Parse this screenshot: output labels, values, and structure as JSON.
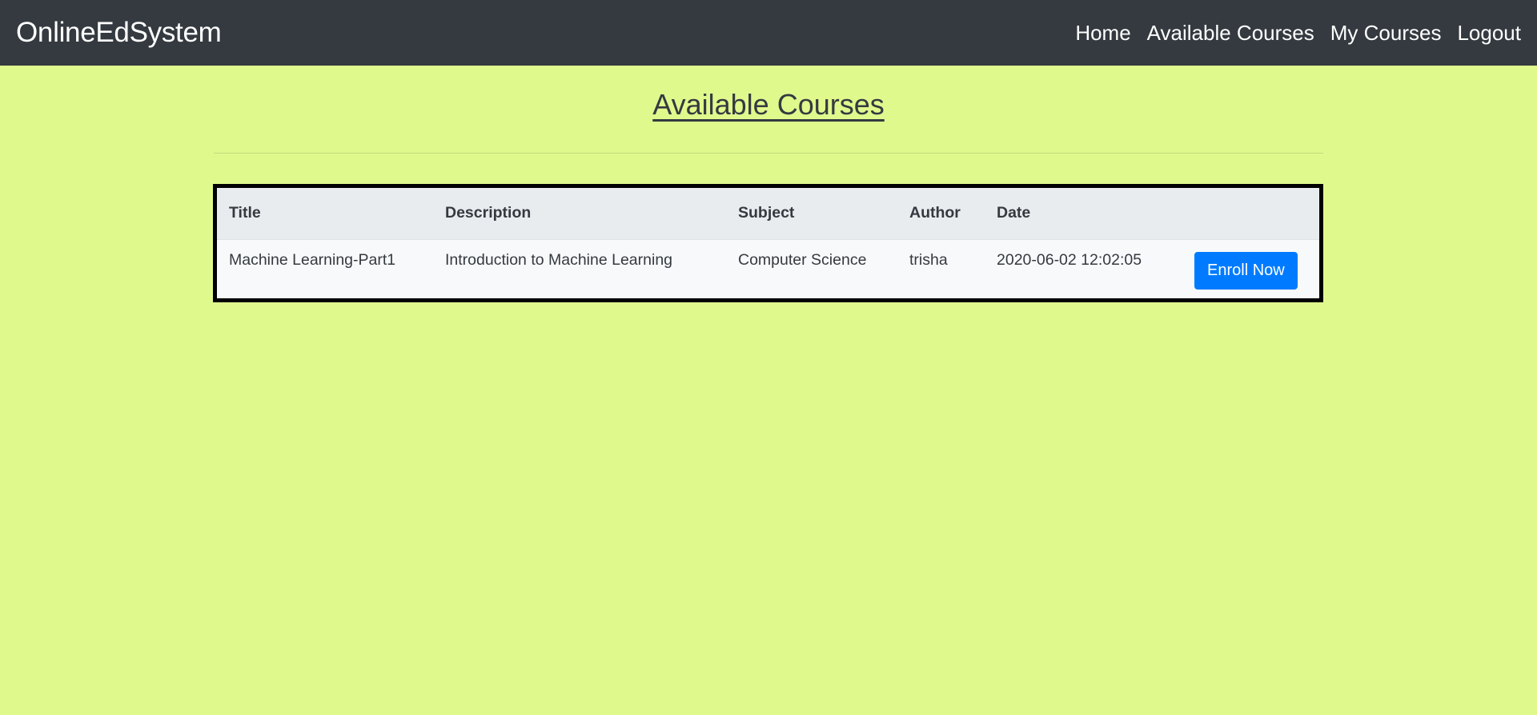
{
  "navbar": {
    "brand": "OnlineEdSystem",
    "links": [
      "Home",
      "Available Courses",
      "My Courses",
      "Logout"
    ]
  },
  "page": {
    "title": "Available Courses"
  },
  "table": {
    "headers": [
      "Title",
      "Description",
      "Subject",
      "Author",
      "Date",
      ""
    ],
    "rows": [
      {
        "title": "Machine Learning-Part1",
        "description": "Introduction to Machine Learning",
        "subject": "Computer Science",
        "author": "trisha",
        "date": "2020-06-02 12:02:05",
        "action_label": "Enroll Now"
      }
    ]
  },
  "colors": {
    "background": "#e0f98d",
    "navbar": "#343a40",
    "button": "#007bff"
  }
}
